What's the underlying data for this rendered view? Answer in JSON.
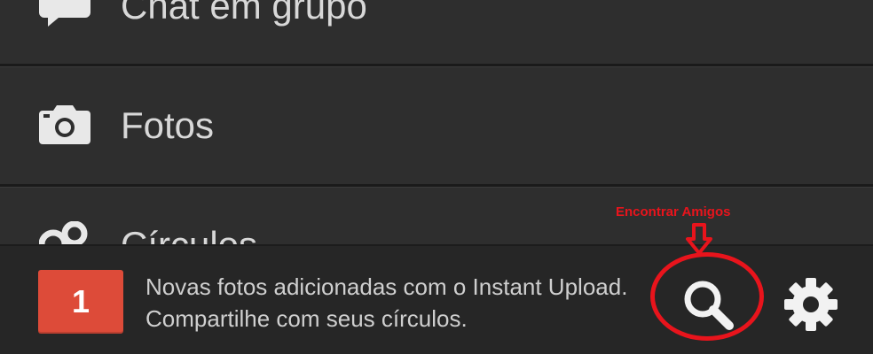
{
  "menu": {
    "items": [
      {
        "label": "Chat em grupo",
        "icon": "chat-bubble-icon"
      },
      {
        "label": "Fotos",
        "icon": "camera-icon"
      },
      {
        "label": "Círculos",
        "icon": "circles-icon"
      }
    ]
  },
  "notification": {
    "count": "1",
    "text": "Novas fotos adicionadas com o Instant Upload. Compartilhe com seus círculos."
  },
  "toolbar": {
    "search_icon": "search-icon",
    "settings_icon": "gear-icon"
  },
  "annotation": {
    "label": "Encontrar Amigos",
    "color": "#e8141c"
  },
  "colors": {
    "badge": "#dd4b39",
    "background": "#2d2d2d",
    "text": "#d8d8d8"
  }
}
